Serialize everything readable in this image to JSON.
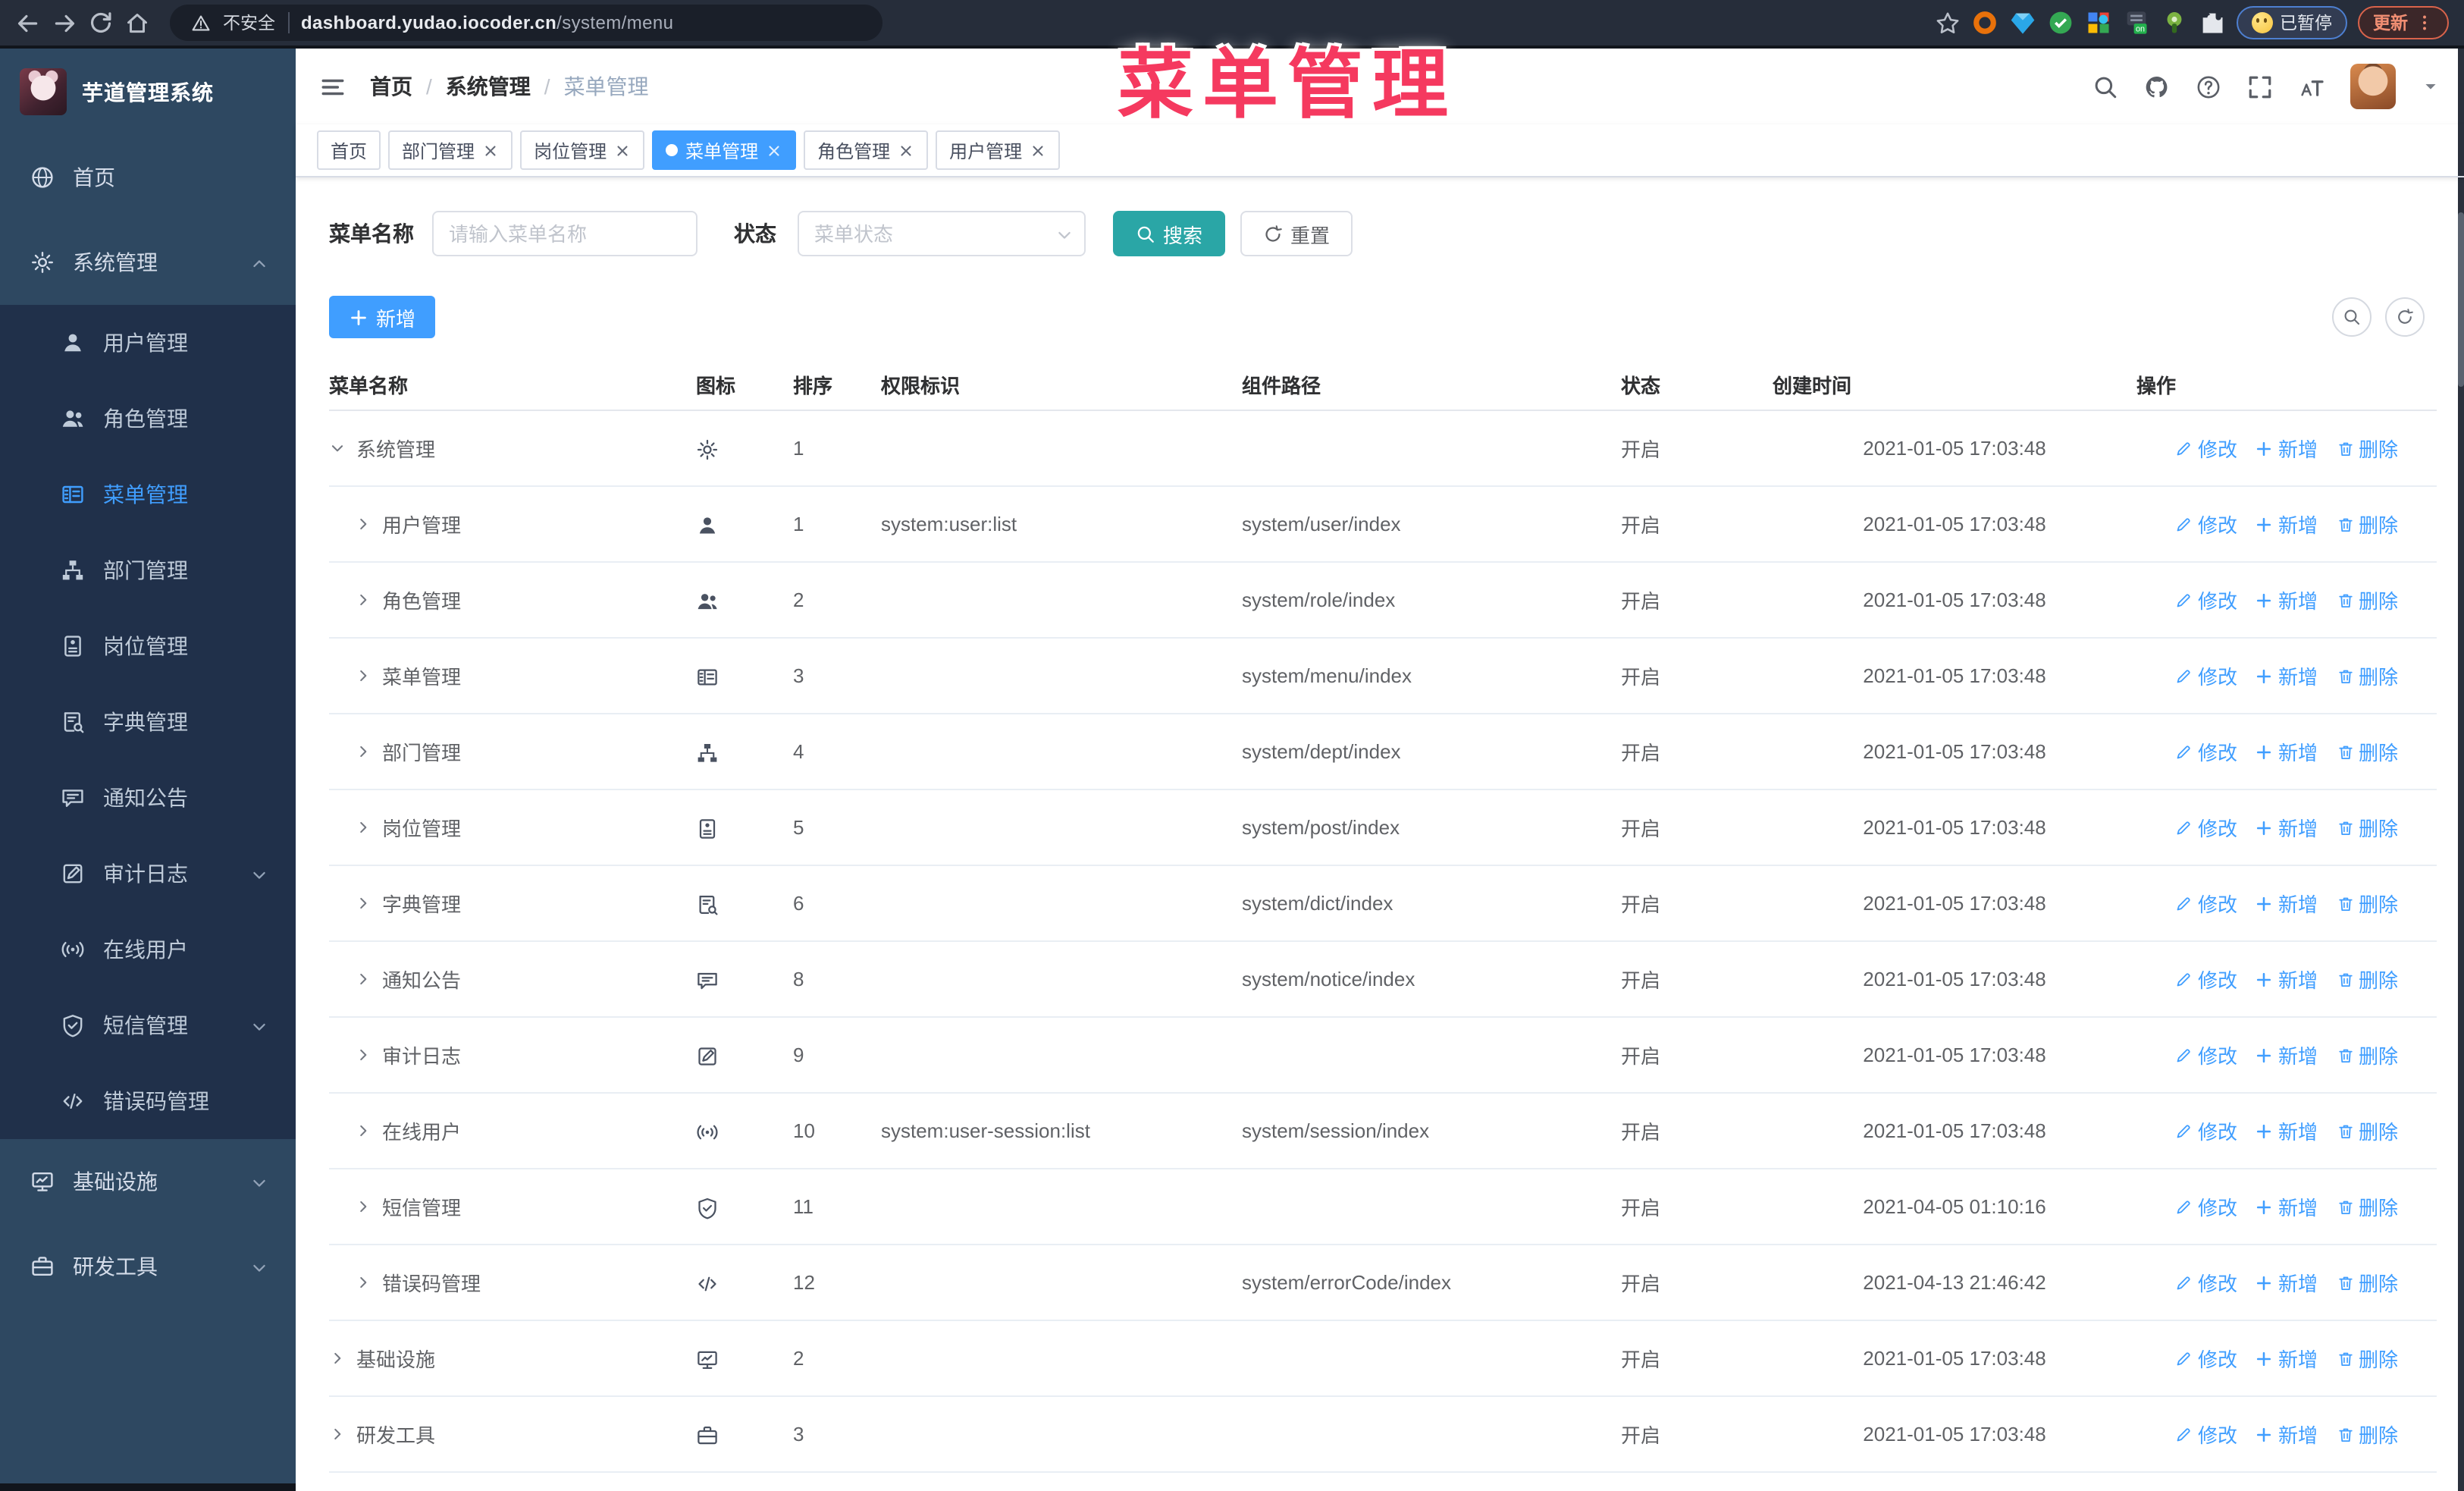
{
  "annotation": {
    "text": "菜单管理"
  },
  "colors": {
    "accent": "#409eff",
    "teal": "#2aa6a6",
    "annotation": "#f5395f"
  },
  "browser": {
    "security_label": "不安全",
    "url_host": "dashboard.yudao.iocoder.cn",
    "url_path": "/system/menu",
    "paused_badge": "已暂停",
    "update_label": "更新",
    "extensions": [
      "ext-ring-icon",
      "ext-gem-icon",
      "ext-shield-check-icon",
      "ext-grid-icon",
      "ext-vpn-on-icon",
      "ext-green-icon",
      "ext-puzzle-icon"
    ]
  },
  "app": {
    "title": "芋道管理系统"
  },
  "breadcrumb": {
    "items": [
      "首页",
      "系统管理",
      "菜单管理"
    ],
    "separator": "/"
  },
  "sidebar": {
    "items": [
      {
        "key": "home",
        "label": "首页",
        "icon": "home-icon",
        "level": 1
      },
      {
        "key": "system",
        "label": "系统管理",
        "icon": "gear-icon",
        "level": 1,
        "arrow": "up"
      },
      {
        "key": "user",
        "label": "用户管理",
        "icon": "user-icon",
        "level": 2
      },
      {
        "key": "role",
        "label": "角色管理",
        "icon": "users-icon",
        "level": 2
      },
      {
        "key": "menu",
        "label": "菜单管理",
        "icon": "menu-icon",
        "level": 2,
        "active": true
      },
      {
        "key": "dept",
        "label": "部门管理",
        "icon": "tree-icon",
        "level": 2
      },
      {
        "key": "post",
        "label": "岗位管理",
        "icon": "badge-icon",
        "level": 2
      },
      {
        "key": "dict",
        "label": "字典管理",
        "icon": "dict-icon",
        "level": 2
      },
      {
        "key": "notice",
        "label": "通知公告",
        "icon": "message-icon",
        "level": 2
      },
      {
        "key": "log",
        "label": "审计日志",
        "icon": "log-icon",
        "level": 2,
        "arrow": "down"
      },
      {
        "key": "online",
        "label": "在线用户",
        "icon": "online-icon",
        "level": 2
      },
      {
        "key": "sms",
        "label": "短信管理",
        "icon": "sms-icon",
        "level": 2,
        "arrow": "down"
      },
      {
        "key": "errcode",
        "label": "错误码管理",
        "icon": "code-icon",
        "level": 2
      },
      {
        "key": "infra",
        "label": "基础设施",
        "icon": "monitor-icon",
        "level": 1,
        "arrow": "down"
      },
      {
        "key": "tool",
        "label": "研发工具",
        "icon": "tool-icon",
        "level": 1,
        "arrow": "down"
      }
    ]
  },
  "tabs": [
    {
      "key": "home",
      "label": "首页",
      "closable": false,
      "active": false
    },
    {
      "key": "dept",
      "label": "部门管理",
      "closable": true,
      "active": false
    },
    {
      "key": "post",
      "label": "岗位管理",
      "closable": true,
      "active": false
    },
    {
      "key": "menu",
      "label": "菜单管理",
      "closable": true,
      "active": true
    },
    {
      "key": "role",
      "label": "角色管理",
      "closable": true,
      "active": false
    },
    {
      "key": "user",
      "label": "用户管理",
      "closable": true,
      "active": false
    }
  ],
  "filters": {
    "name_label": "菜单名称",
    "name_placeholder": "请输入菜单名称",
    "status_label": "状态",
    "status_placeholder": "菜单状态",
    "search_label": "搜索",
    "reset_label": "重置"
  },
  "toolbar": {
    "add_label": "新增"
  },
  "table": {
    "columns": [
      "菜单名称",
      "图标",
      "排序",
      "权限标识",
      "组件路径",
      "状态",
      "创建时间",
      "操作"
    ],
    "action_labels": [
      "修改",
      "新增",
      "删除"
    ],
    "rows": [
      {
        "key": "system",
        "name": "系统管理",
        "level": 1,
        "expand": "expanded",
        "icon": "gear-icon",
        "sort": "1",
        "perm": "",
        "component": "",
        "status": "开启",
        "created": "2021-01-05 17:03:48"
      },
      {
        "key": "user",
        "name": "用户管理",
        "level": 2,
        "expand": "collapsed",
        "icon": "user-icon",
        "sort": "1",
        "perm": "system:user:list",
        "component": "system/user/index",
        "status": "开启",
        "created": "2021-01-05 17:03:48"
      },
      {
        "key": "role",
        "name": "角色管理",
        "level": 2,
        "expand": "collapsed",
        "icon": "users-icon",
        "sort": "2",
        "perm": "",
        "component": "system/role/index",
        "status": "开启",
        "created": "2021-01-05 17:03:48"
      },
      {
        "key": "menu",
        "name": "菜单管理",
        "level": 2,
        "expand": "collapsed",
        "icon": "menu-icon",
        "sort": "3",
        "perm": "",
        "component": "system/menu/index",
        "status": "开启",
        "created": "2021-01-05 17:03:48"
      },
      {
        "key": "dept",
        "name": "部门管理",
        "level": 2,
        "expand": "collapsed",
        "icon": "tree-icon",
        "sort": "4",
        "perm": "",
        "component": "system/dept/index",
        "status": "开启",
        "created": "2021-01-05 17:03:48"
      },
      {
        "key": "post",
        "name": "岗位管理",
        "level": 2,
        "expand": "collapsed",
        "icon": "badge-icon",
        "sort": "5",
        "perm": "",
        "component": "system/post/index",
        "status": "开启",
        "created": "2021-01-05 17:03:48"
      },
      {
        "key": "dict",
        "name": "字典管理",
        "level": 2,
        "expand": "collapsed",
        "icon": "dict-icon",
        "sort": "6",
        "perm": "",
        "component": "system/dict/index",
        "status": "开启",
        "created": "2021-01-05 17:03:48"
      },
      {
        "key": "notice",
        "name": "通知公告",
        "level": 2,
        "expand": "collapsed",
        "icon": "message-icon",
        "sort": "8",
        "perm": "",
        "component": "system/notice/index",
        "status": "开启",
        "created": "2021-01-05 17:03:48"
      },
      {
        "key": "log",
        "name": "审计日志",
        "level": 2,
        "expand": "collapsed",
        "icon": "log-icon",
        "sort": "9",
        "perm": "",
        "component": "",
        "status": "开启",
        "created": "2021-01-05 17:03:48"
      },
      {
        "key": "online",
        "name": "在线用户",
        "level": 2,
        "expand": "collapsed",
        "icon": "online-icon",
        "sort": "10",
        "perm": "system:user-session:list",
        "component": "system/session/index",
        "status": "开启",
        "created": "2021-01-05 17:03:48"
      },
      {
        "key": "sms",
        "name": "短信管理",
        "level": 2,
        "expand": "collapsed",
        "icon": "sms-icon",
        "sort": "11",
        "perm": "",
        "component": "",
        "status": "开启",
        "created": "2021-04-05 01:10:16"
      },
      {
        "key": "errcode",
        "name": "错误码管理",
        "level": 2,
        "expand": "collapsed",
        "icon": "code-icon",
        "sort": "12",
        "perm": "",
        "component": "system/errorCode/index",
        "status": "开启",
        "created": "2021-04-13 21:46:42"
      },
      {
        "key": "infra",
        "name": "基础设施",
        "level": 1,
        "expand": "collapsed",
        "icon": "monitor-icon",
        "sort": "2",
        "perm": "",
        "component": "",
        "status": "开启",
        "created": "2021-01-05 17:03:48"
      },
      {
        "key": "tool",
        "name": "研发工具",
        "level": 1,
        "expand": "collapsed",
        "icon": "tool-icon",
        "sort": "3",
        "perm": "",
        "component": "",
        "status": "开启",
        "created": "2021-01-05 17:03:48"
      }
    ]
  }
}
